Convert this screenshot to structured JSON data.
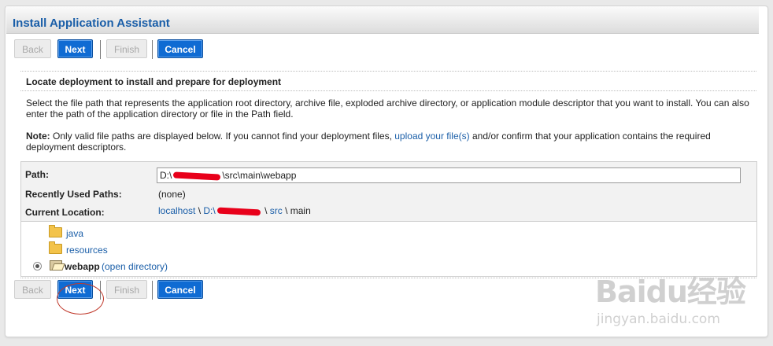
{
  "panel": {
    "title": "Install Application Assistant"
  },
  "toolbar": {
    "back_label": "Back",
    "next_label": "Next",
    "finish_label": "Finish",
    "cancel_label": "Cancel"
  },
  "content": {
    "section_title": "Locate deployment to install and prepare for deployment",
    "description": "Select the file path that represents the application root directory, archive file, exploded archive directory, or application module descriptor that you want to install. You can also enter the path of the application directory or file in the Path field.",
    "note_label": "Note:",
    "note_text_before": " Only valid file paths are displayed below. If you cannot find your deployment files, ",
    "note_link": "upload your file(s)",
    "note_text_after": " and/or confirm that your application contains the required deployment descriptors."
  },
  "form": {
    "path_label": "Path:",
    "path_value": "D:\\████\\src\\main\\webapp",
    "recent_label": "Recently Used Paths:",
    "recent_value": "(none)",
    "location_label": "Current Location:",
    "location_crumbs": [
      "localhost",
      "D:\\",
      "src"
    ],
    "location_current": "main",
    "crumb_separator": " \\ "
  },
  "tree": {
    "items": [
      {
        "label": "java",
        "type": "folder"
      },
      {
        "label": "resources",
        "type": "folder"
      },
      {
        "label": "webapp",
        "type": "selected-folder",
        "action": "(open directory)"
      }
    ]
  },
  "watermark": {
    "logo": "Baidu经验",
    "url": "jingyan.baidu.com"
  },
  "colors": {
    "accent": "#0f6bd3",
    "title": "#1a5ea8",
    "annotation": "#c0392b",
    "redaction": "#e8001a"
  }
}
